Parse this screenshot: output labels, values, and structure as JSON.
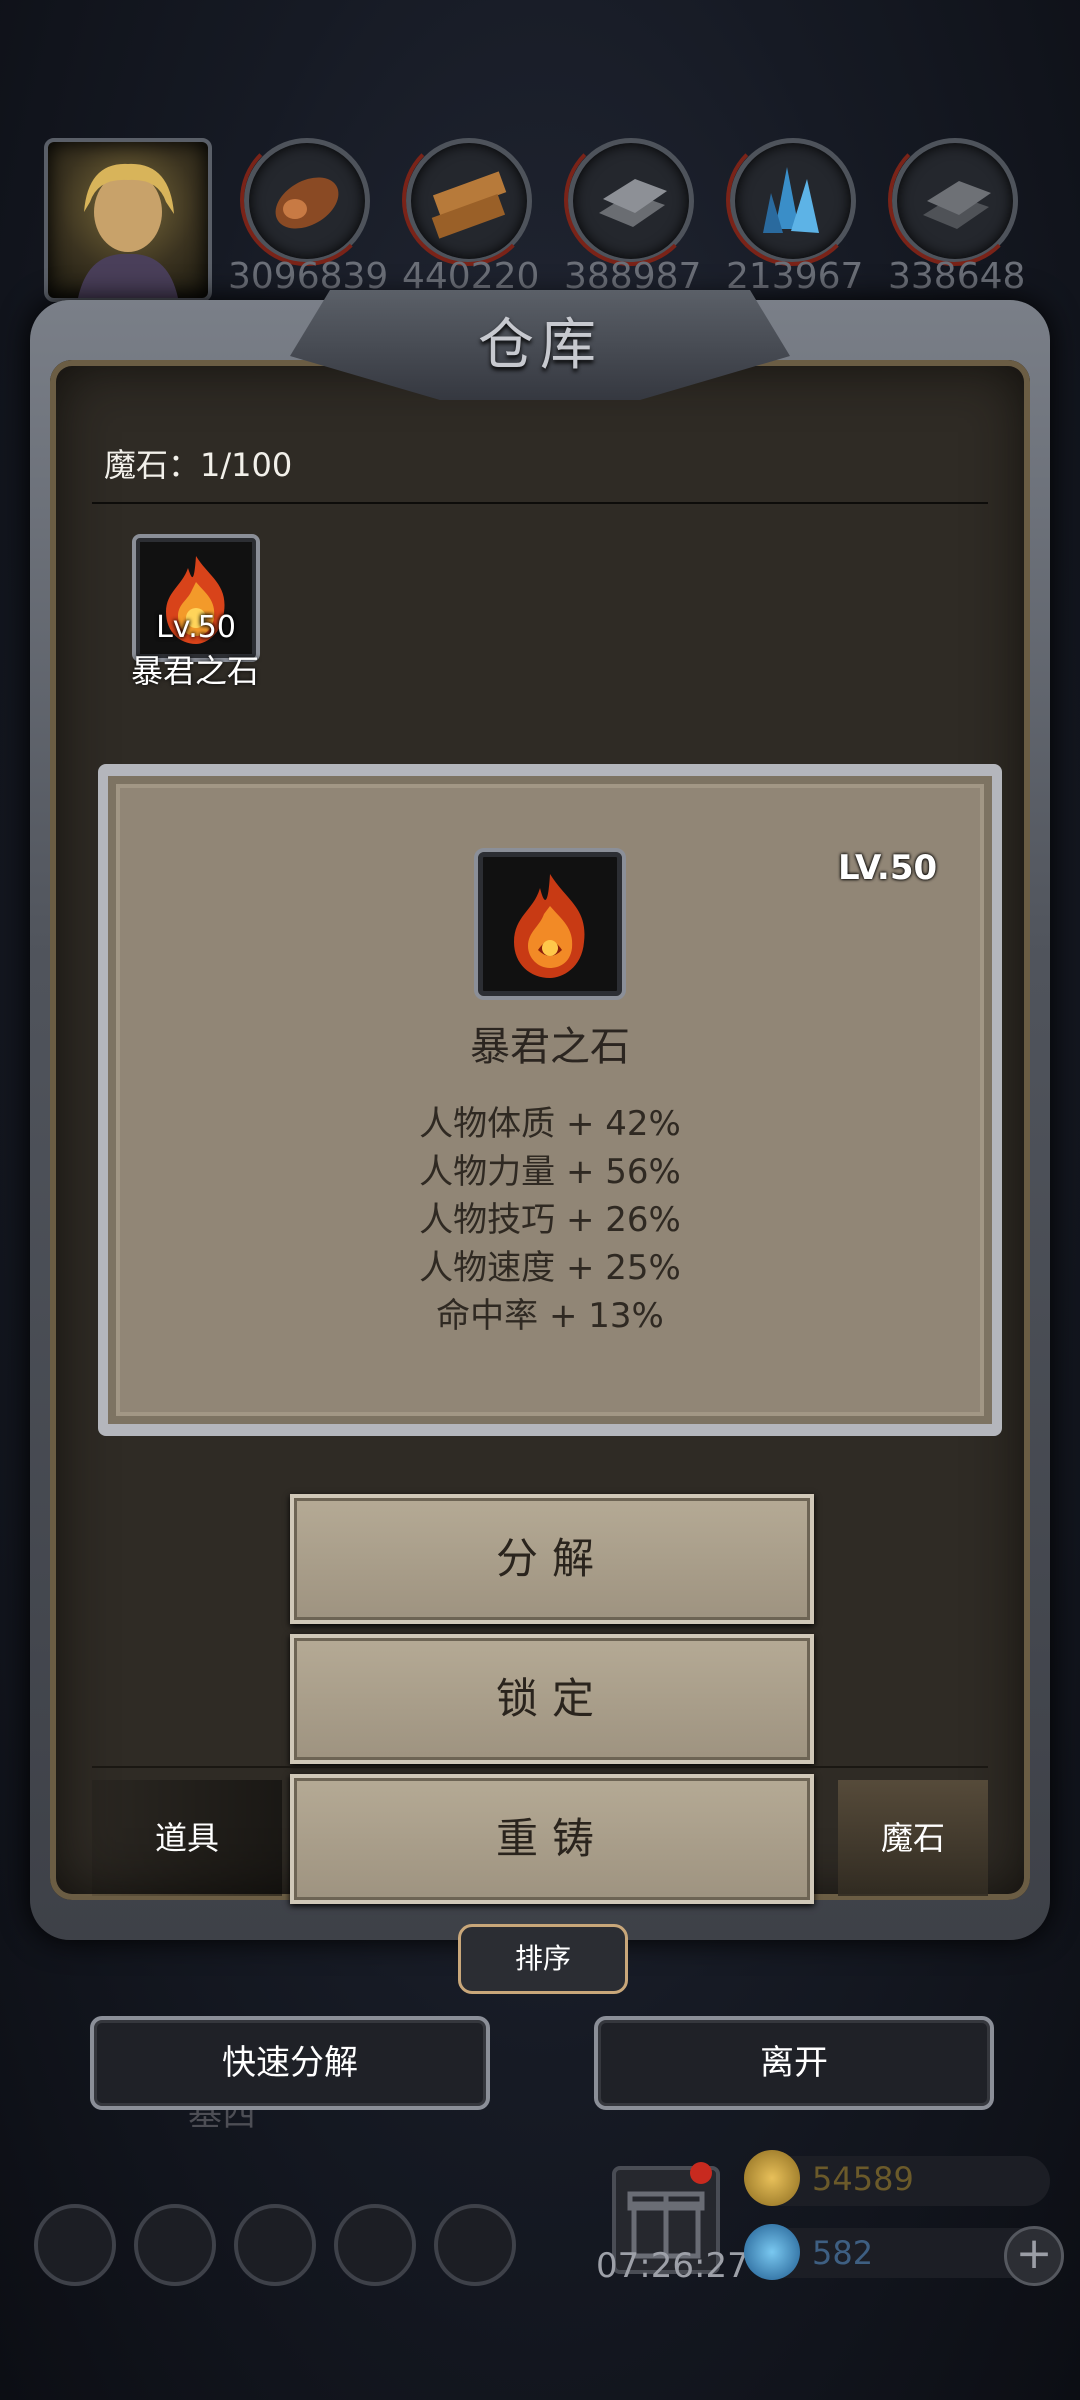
{
  "resources": [
    "3096839",
    "440220",
    "388987",
    "213967",
    "338648"
  ],
  "panel": {
    "title": "仓库"
  },
  "inventory": {
    "count_label": "魔石：1/100"
  },
  "items": [
    {
      "level": "Lv.50",
      "name": "暴君之石"
    }
  ],
  "detail": {
    "level": "LV.50",
    "name": "暴君之石",
    "stats": [
      "人物体质 + 42%",
      "人物力量 + 56%",
      "人物技巧 + 26%",
      "人物速度 + 25%",
      "命中率 + 13%"
    ]
  },
  "actions": {
    "decompose": "分解",
    "lock": "锁定",
    "reforge": "重铸"
  },
  "tabs": {
    "props": "道具",
    "magic_stone": "魔石"
  },
  "sort_label": "排序",
  "bottom": {
    "quick_decompose": "快速分解",
    "leave": "离开"
  },
  "hud": {
    "background_text": "基西",
    "timer": "07:26:27",
    "gold": "54589",
    "gems": "582",
    "plus": "+"
  },
  "colors": {
    "accent_gold": "#c9a77a",
    "card_bg": "#918676",
    "button_bg": "#b5aa95"
  }
}
